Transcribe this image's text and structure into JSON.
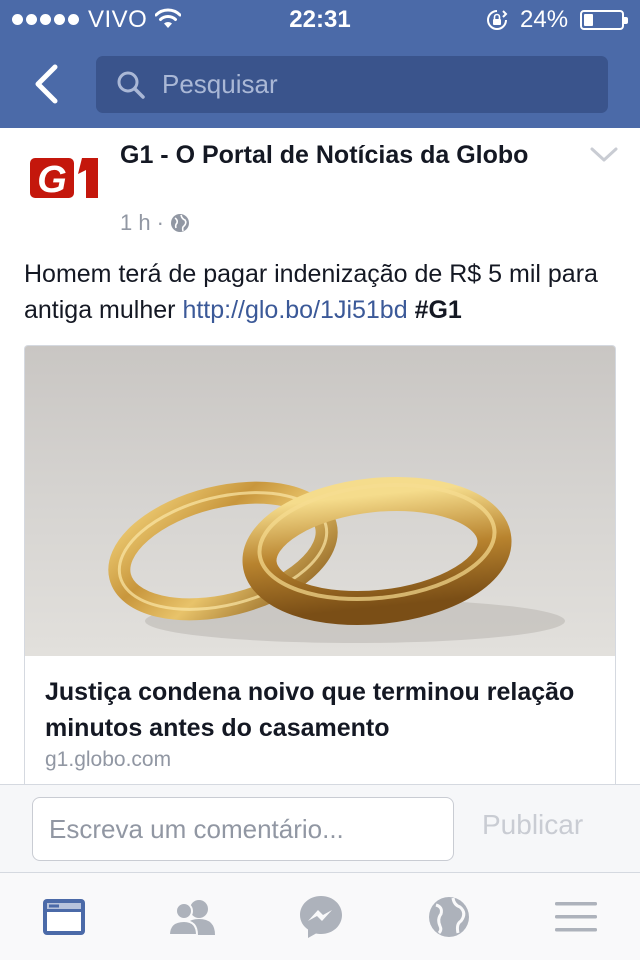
{
  "status_bar": {
    "carrier": "VIVO",
    "time": "22:31",
    "battery_percent": "24%",
    "battery_level": 0.24
  },
  "nav": {
    "back_icon": "chevron-left-icon",
    "search_placeholder": "Pesquisar",
    "search_icon": "search-icon"
  },
  "post": {
    "page_name": "G1 - O Portal de Notícias da Globo",
    "logo_text": "G1",
    "time_ago": "1 h",
    "separator": "·",
    "privacy_icon": "globe-icon",
    "text": "Homem terá de pagar indenização de R$ 5 mil para antiga mulher ",
    "link": "http://glo.bo/1Ji51bd",
    "hashtag_prefix": "#",
    "hashtag": "G1",
    "link_card": {
      "image": "gold-wedding-rings-photo",
      "title": "Justiça condena noivo que terminou relação minutos antes do casamento",
      "domain": "g1.globo.com"
    }
  },
  "comment": {
    "placeholder": "Escreva um comentário...",
    "publish_label": "Publicar"
  },
  "tabs": [
    {
      "name": "news-feed",
      "icon": "news-feed-icon",
      "active": true
    },
    {
      "name": "friend-requests",
      "icon": "friends-icon",
      "active": false
    },
    {
      "name": "messenger",
      "icon": "messenger-icon",
      "active": false
    },
    {
      "name": "notifications",
      "icon": "globe-icon",
      "active": false
    },
    {
      "name": "more",
      "icon": "menu-icon",
      "active": false
    }
  ],
  "colors": {
    "header": "#4b6aa8",
    "search_bg": "#3a548c",
    "link": "#3b5998",
    "active_tab": "#4b6aa8",
    "inactive_tab": "#adb2bb",
    "g1_red": "#c4170c"
  }
}
